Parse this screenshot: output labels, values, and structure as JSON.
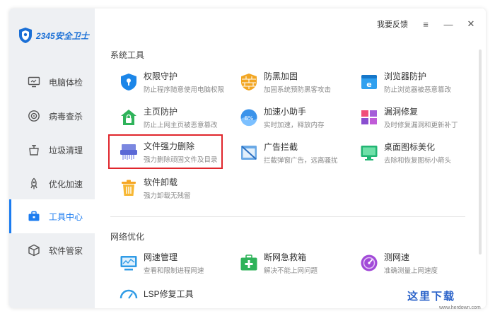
{
  "app": {
    "logo_text": "2345安全卫士",
    "brand_color": "#1a6fd6",
    "accent_color": "#1c7cf0"
  },
  "titlebar": {
    "feedback_label": "我要反馈",
    "menu_icon": "≡",
    "minimize_icon": "—",
    "close_icon": "✕"
  },
  "sidebar": {
    "items": [
      {
        "label": "电脑体检",
        "icon": "monitor-icon"
      },
      {
        "label": "病毒查杀",
        "icon": "target-icon"
      },
      {
        "label": "垃圾清理",
        "icon": "trash-cleanup-icon"
      },
      {
        "label": "优化加速",
        "icon": "rocket-icon"
      },
      {
        "label": "工具中心",
        "icon": "toolbox-icon",
        "active": true
      },
      {
        "label": "软件管家",
        "icon": "cube-icon"
      }
    ]
  },
  "sections": [
    {
      "title": "系统工具",
      "tools": [
        {
          "name": "权限守护",
          "desc": "防止程序随意使用电脑权限",
          "icon": "shield-lock-icon"
        },
        {
          "name": "防黑加固",
          "desc": "加固系统预防黑客攻击",
          "icon": "brick-shield-icon"
        },
        {
          "name": "浏览器防护",
          "desc": "防止浏览器被恶意篡改",
          "icon": "browser-shield-icon"
        },
        {
          "name": "主页防护",
          "desc": "防止上网主页被恶意篡改",
          "icon": "home-lock-icon"
        },
        {
          "name": "加速小助手",
          "desc": "实时加速，释放内存",
          "icon": "speed-ball-icon"
        },
        {
          "name": "漏洞修复",
          "desc": "及时修复漏洞和更新补丁",
          "icon": "windows-patch-icon"
        },
        {
          "name": "文件强力删除",
          "desc": "强力删除顽固文件及目录",
          "icon": "shredder-icon"
        },
        {
          "name": "广告拦截",
          "desc": "拦截弹窗广告，远离骚扰",
          "icon": "ad-block-icon"
        },
        {
          "name": "桌面图标美化",
          "desc": "去除和恢复图标小箭头",
          "icon": "desktop-icon"
        },
        {
          "name": "软件卸载",
          "desc": "强力卸载无残留",
          "icon": "trash-bin-icon"
        }
      ]
    },
    {
      "title": "网络优化",
      "tools": [
        {
          "name": "网速管理",
          "desc": "查看和限制进程网速",
          "icon": "network-monitor-icon"
        },
        {
          "name": "断网急救箱",
          "desc": "解决不能上网问题",
          "icon": "first-aid-kit-icon"
        },
        {
          "name": "测网速",
          "desc": "准确测量上网速度",
          "icon": "speedometer-icon"
        },
        {
          "name": "LSP修复工具",
          "desc": "",
          "icon": "lsp-gauge-icon"
        }
      ]
    }
  ],
  "watermark": {
    "text": "这里下载",
    "url": "www.herdown.com"
  }
}
